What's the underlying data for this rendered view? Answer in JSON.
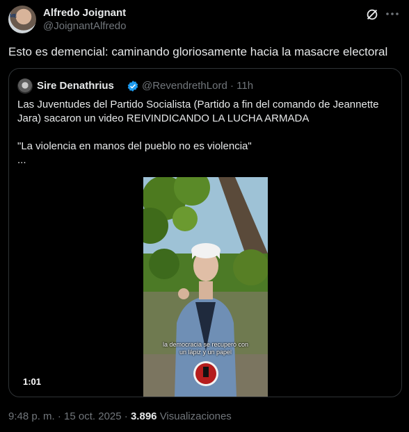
{
  "author": {
    "name": "Alfredo Joignant",
    "handle": "@JoignantAlfredo",
    "avatar_tag": "ME"
  },
  "tweet": {
    "text": "Esto es demencial: caminando gloriosamente hacia la masacre electoral"
  },
  "quoted": {
    "name": "Sire Denathrius",
    "handle": "@RevendrethLord",
    "time": "11h",
    "separator": "·",
    "line1": "Las Juventudes del Partido Socialista (Partido a fin del comando de Jeannette Jara) sacaron un video REIVINDICANDO LA LUCHA ARMADA",
    "line2": "\"La violencia en manos del pueblo no es violencia\"",
    "line3": "...",
    "video": {
      "caption_line1": "la democracia se recuperó con",
      "caption_line2": "un lápiz y un papel",
      "duration": "1:01"
    }
  },
  "footer": {
    "time": "9:48 p. m.",
    "sep1": "·",
    "date": "15 oct. 2025",
    "sep2": "·",
    "views_count": "3.896",
    "views_label": "Visualizaciones"
  },
  "icons": {
    "grok": "grok-icon",
    "more": "more-icon",
    "verified": "verified-badge-icon"
  },
  "colors": {
    "background": "#000000",
    "text": "#e7e9ea",
    "muted": "#71767b",
    "border": "#2f3336",
    "verified": "#1d9bf0"
  }
}
